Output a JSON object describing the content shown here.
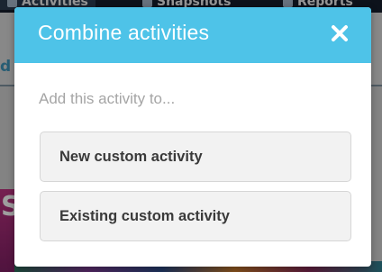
{
  "background": {
    "tabs": [
      {
        "label": "Activities"
      },
      {
        "label": "Snapshots"
      },
      {
        "label": "Reports"
      }
    ],
    "subbar_text": "d",
    "strip_text": "S"
  },
  "modal": {
    "title": "Combine activities",
    "close_glyph": "close-icon",
    "prompt": "Add this activity to...",
    "options": [
      {
        "label": "New custom activity"
      },
      {
        "label": "Existing custom activity"
      }
    ]
  },
  "colors": {
    "header_bg": "#4ec3e8",
    "button_bg": "#f2f2f2",
    "button_border": "#d6d6d6",
    "prompt_text": "#a5a5a5",
    "button_text": "#3a3a3a"
  }
}
